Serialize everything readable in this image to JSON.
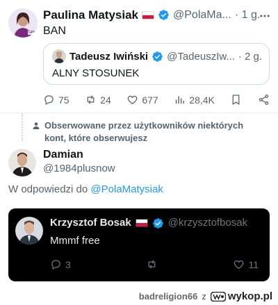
{
  "tweet1": {
    "name": "Paulina Matysiak",
    "handle": "@PolaMa...",
    "time": "· 1 g.",
    "text": "BAN",
    "avatar_badge": "GPK",
    "quote": {
      "name": "Tadeusz Iwiński",
      "handle": "@TadeuszIw...",
      "time": "· 2 g.",
      "text": "ALNY STOSUNEK"
    },
    "actions": {
      "replies": "75",
      "reposts": "24",
      "likes": "677",
      "views": "28,4K"
    }
  },
  "info_notice": "Obserwowane przez użytkowników niektórych kont, które obserwujesz",
  "tweet2": {
    "name": "Damian",
    "handle": "@1984plusnow",
    "reply_prefix": "W odpowiedzi do ",
    "reply_target": "@PolaMatysiak"
  },
  "embedded": {
    "name": "Krzysztof Bosak",
    "handle": "@krzysztofbosak",
    "text": "Mmmf free",
    "replies": "3",
    "likes": "11"
  },
  "footer": {
    "user": "badreligion66",
    "separator": "z",
    "brand": "wykop.pl"
  },
  "colors": {
    "verified": "#1d9bf0",
    "link": "#1d9bf0",
    "muted": "#536471",
    "flag_red": "#dc143c"
  }
}
